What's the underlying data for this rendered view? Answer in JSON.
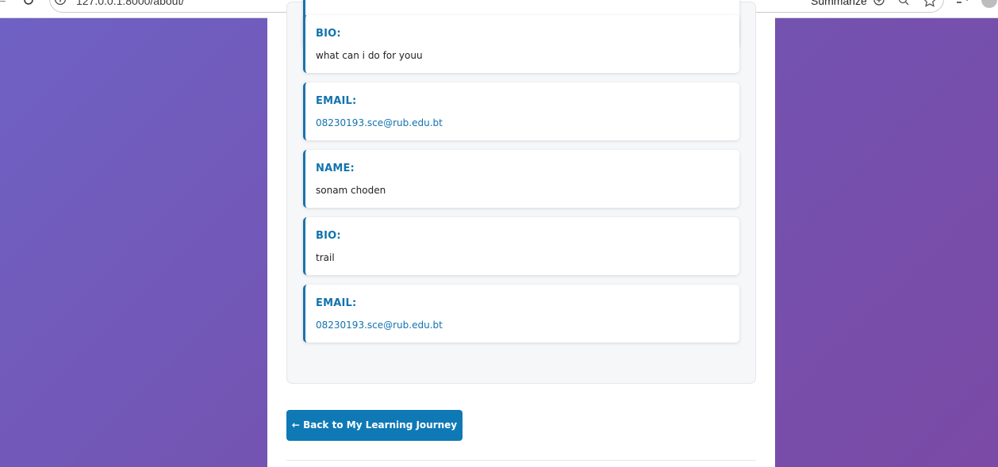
{
  "browser": {
    "url": "127.0.0.1:8000/about/",
    "summarize_label": "Summarize",
    "icons": [
      "back-icon",
      "reload-icon",
      "site-info-icon",
      "summarize-icon",
      "zoom-icon",
      "star-icon",
      "tab-search-icon",
      "profile-avatar"
    ]
  },
  "entries": [
    {
      "label": "BIO:",
      "value": "what can i do for youu",
      "type": "text"
    },
    {
      "label": "EMAIL:",
      "value": "08230193.sce@rub.edu.bt",
      "type": "link"
    },
    {
      "label": "NAME:",
      "value": "sonam choden",
      "type": "text"
    },
    {
      "label": "BIO:",
      "value": "trail",
      "type": "text"
    },
    {
      "label": "EMAIL:",
      "value": "08230193.sce@rub.edu.bt",
      "type": "link"
    }
  ],
  "actions": {
    "back_label": "← Back to My Learning Journey"
  },
  "colors": {
    "accent": "#1173ad",
    "button": "#0f79b6",
    "background_gradient_start": "#6f62c4",
    "background_gradient_end": "#7a4aa6"
  }
}
